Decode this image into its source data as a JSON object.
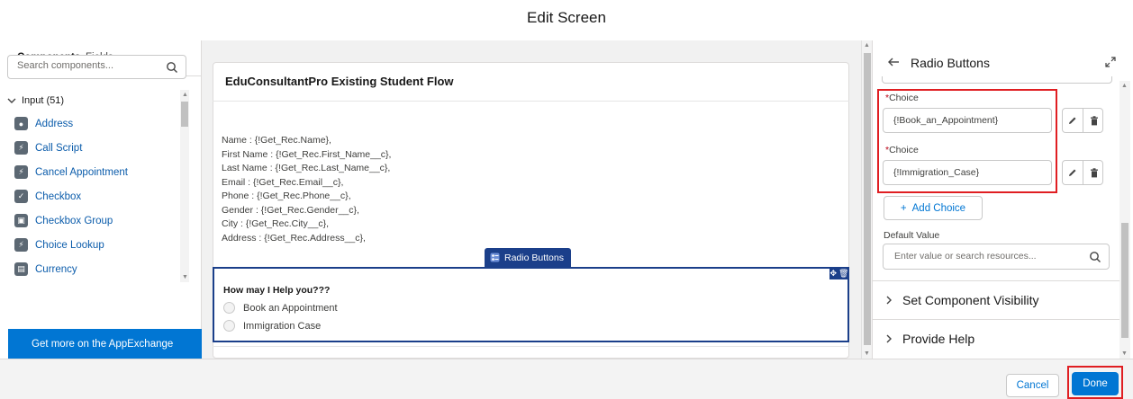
{
  "modal": {
    "title": "Edit Screen"
  },
  "left_panel": {
    "tabs": [
      {
        "label": "Components",
        "active": true
      },
      {
        "label": "Fields",
        "active": false
      }
    ],
    "search": {
      "placeholder": "Search components..."
    },
    "section": {
      "label": "Input (51)"
    },
    "components": [
      {
        "label": "Address",
        "icon": "address-icon"
      },
      {
        "label": "Call Script",
        "icon": "call-script-icon"
      },
      {
        "label": "Cancel Appointment",
        "icon": "cancel-appointment-icon"
      },
      {
        "label": "Checkbox",
        "icon": "checkbox-icon"
      },
      {
        "label": "Checkbox Group",
        "icon": "checkbox-group-icon"
      },
      {
        "label": "Choice Lookup",
        "icon": "choice-lookup-icon"
      },
      {
        "label": "Currency",
        "icon": "currency-icon"
      }
    ],
    "appexchange": "Get more on the AppExchange"
  },
  "canvas": {
    "title": "EduConsultantPro Existing Student Flow",
    "merge_fields": [
      "Name : {!Get_Rec.Name},",
      "First Name : {!Get_Rec.First_Name__c},",
      "Last Name : {!Get_Rec.Last_Name__c},",
      "Email : {!Get_Rec.Email__c},",
      "Phone : {!Get_Rec.Phone__c},",
      "Gender : {!Get_Rec.Gender__c},",
      "City : {!Get_Rec.City__c},",
      "Address : {!Get_Rec.Address__c},"
    ],
    "radio_tag": "Radio Buttons",
    "radio_question": "How may I Help you???",
    "radio_options": [
      "Book an Appointment",
      "Immigration Case"
    ]
  },
  "right_panel": {
    "title": "Radio Buttons",
    "choices": [
      {
        "label": "Choice",
        "value": "{!Book_an_Appointment}"
      },
      {
        "label": "Choice",
        "value": "{!Immigration_Case}"
      }
    ],
    "add_choice": "Add Choice",
    "default_value": {
      "label": "Default Value",
      "placeholder": "Enter value or search resources..."
    },
    "sections": [
      "Set Component Visibility",
      "Provide Help"
    ]
  },
  "footer": {
    "cancel": "Cancel",
    "done": "Done"
  },
  "colors": {
    "brand": "#0176d3",
    "selection": "#1b3f8a",
    "highlight": "#e01e22"
  }
}
